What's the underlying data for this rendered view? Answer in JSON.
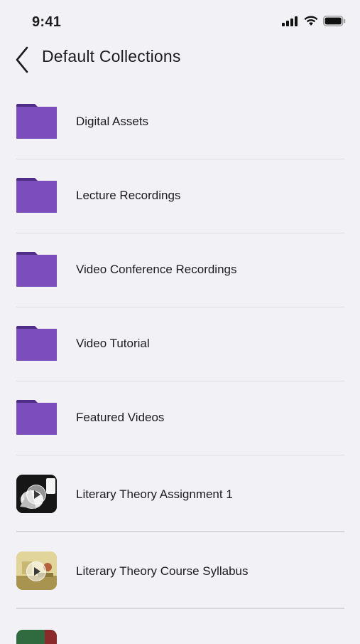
{
  "status": {
    "time": "9:41"
  },
  "nav": {
    "title": "Default Collections"
  },
  "folders": [
    {
      "label": "Digital Assets",
      "icon": "folder-icon"
    },
    {
      "label": "Lecture Recordings",
      "icon": "folder-icon"
    },
    {
      "label": "Video Conference Recordings",
      "icon": "folder-icon"
    },
    {
      "label": "Video Tutorial",
      "icon": "folder-icon"
    },
    {
      "label": "Featured Videos",
      "icon": "folder-icon"
    }
  ],
  "media": [
    {
      "label": "Literary Theory Assignment 1",
      "icon": "video-thumbnail"
    },
    {
      "label": "Literary Theory Course Syllabus",
      "icon": "video-thumbnail"
    }
  ],
  "colors": {
    "folder": "#7a4ebd",
    "folder_tab": "#4d2d86",
    "background": "#f2f2f6"
  }
}
